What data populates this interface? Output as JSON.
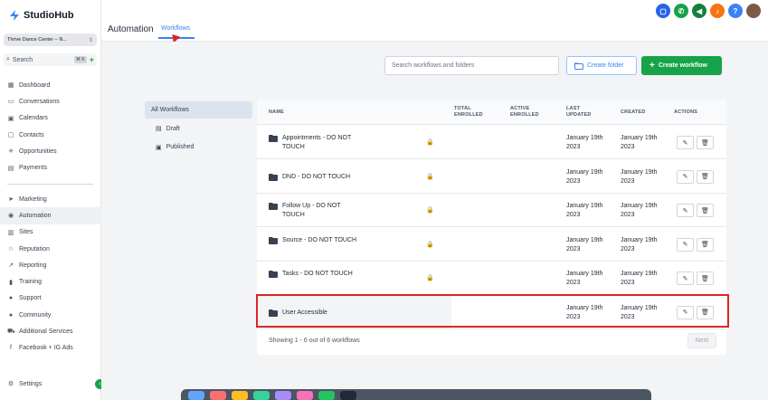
{
  "app": {
    "name": "StudioHub"
  },
  "sidebar": {
    "account": "Thrive Dance Center -- N...",
    "search_label": "Search",
    "search_shortcut": "⌘ K",
    "items_top": [
      {
        "label": "Dashboard",
        "icon": "dashboard-icon"
      },
      {
        "label": "Conversations",
        "icon": "chat-icon"
      },
      {
        "label": "Calendars",
        "icon": "calendar-icon"
      },
      {
        "label": "Contacts",
        "icon": "contacts-icon"
      },
      {
        "label": "Opportunities",
        "icon": "opportunities-icon"
      },
      {
        "label": "Payments",
        "icon": "payments-icon"
      }
    ],
    "items_bottom": [
      {
        "label": "Marketing",
        "icon": "send-icon"
      },
      {
        "label": "Automation",
        "icon": "automation-icon",
        "active": true
      },
      {
        "label": "Sites",
        "icon": "sites-icon"
      },
      {
        "label": "Reputation",
        "icon": "star-icon"
      },
      {
        "label": "Reporting",
        "icon": "chart-icon"
      },
      {
        "label": "Training",
        "icon": "book-icon"
      },
      {
        "label": "Support",
        "icon": "support-icon"
      },
      {
        "label": "Community",
        "icon": "community-icon"
      },
      {
        "label": "Additional Services",
        "icon": "cart-icon"
      },
      {
        "label": "Facebook + IG Ads",
        "icon": "facebook-icon"
      }
    ],
    "settings": "Settings"
  },
  "header": {
    "title": "Automation",
    "tab": "Workflows",
    "icon_colors": {
      "chat": "#2563eb",
      "phone": "#16a34a",
      "megaphone": "#15803d",
      "bell": "#f97316",
      "help": "#3b82f6"
    }
  },
  "toolbar": {
    "search_placeholder": "Search workflows and folders",
    "create_folder": "Create folder",
    "create_workflow": "Create workflow"
  },
  "filters": {
    "all": "All Workflows",
    "draft": "Draft",
    "published": "Published"
  },
  "table": {
    "columns": {
      "name": "NAME",
      "total_enrolled": [
        "TOTAL",
        "ENROLLED"
      ],
      "active_enrolled": [
        "ACTIVE",
        "ENROLLED"
      ],
      "last_updated": [
        "LAST",
        "UPDATED"
      ],
      "created": "CREATED",
      "actions": "ACTIONS"
    },
    "rows": [
      {
        "name": "Appointments - DO NOT TOUCH",
        "updated": "January 19th 2023",
        "created": "January 19th 2023",
        "locked": true
      },
      {
        "name": "DND - DO NOT TOUCH",
        "updated": "January 19th 2023",
        "created": "January 19th 2023",
        "locked": true
      },
      {
        "name": "Follow Up - DO NOT TOUCH",
        "updated": "January 19th 2023",
        "created": "January 19th 2023",
        "locked": true
      },
      {
        "name": "Source - DO NOT TOUCH",
        "updated": "January 19th 2023",
        "created": "January 19th 2023",
        "locked": true
      },
      {
        "name": "Tasks - DO NOT TOUCH",
        "updated": "January 19th 2023",
        "created": "January 19th 2023",
        "locked": true
      },
      {
        "name": "User Accessible",
        "updated": "January 19th 2023",
        "created": "January 19th 2023",
        "locked": false
      }
    ],
    "footer": "Showing 1 - 6 out of 6 workflows",
    "next": "Next"
  },
  "colors": {
    "accent": "#3b82f6",
    "primary_button": "#16a34a",
    "highlight": "#dc2626"
  }
}
